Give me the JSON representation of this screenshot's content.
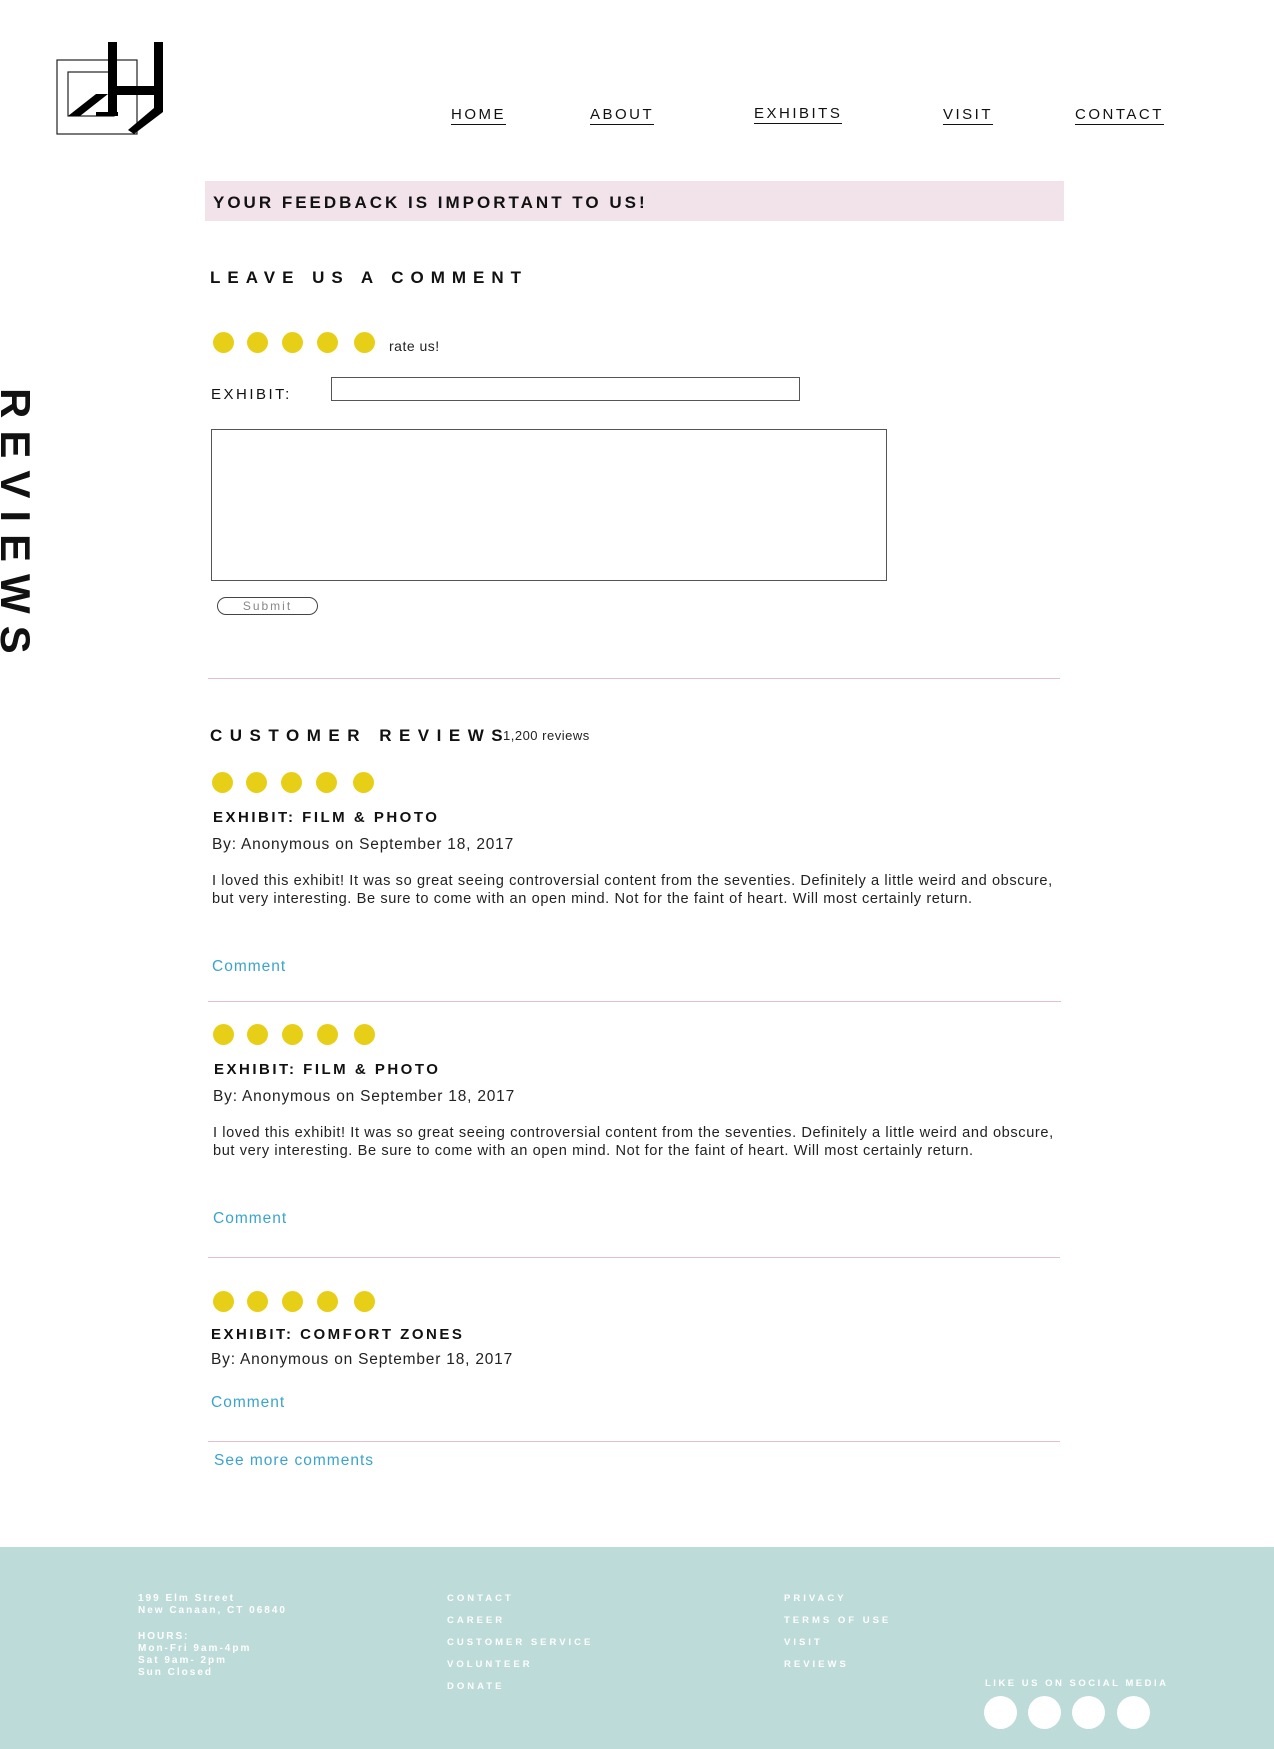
{
  "nav": {
    "home": "HOME",
    "about": "ABOUT",
    "exhibits": "EXHIBITS",
    "visit": "VISIT",
    "contact": "CONTACT"
  },
  "side_title": "REVIEWS",
  "banner": "YOUR FEEDBACK IS IMPORTANT TO US!",
  "form": {
    "heading": "LEAVE US A COMMENT",
    "rating": 5,
    "rate_label": "rate us!",
    "exhibit_label": "EXHIBIT:",
    "exhibit_value": "",
    "comment_value": "",
    "submit_label": "Submit"
  },
  "reviews": {
    "heading": "CUSTOMER REVIEWS",
    "count": "1,200 reviews",
    "items": [
      {
        "rating": 5,
        "exhibit": "EXHIBIT: FILM & PHOTO",
        "byline": "By: Anonymous on September 18, 2017",
        "text": "I loved this exhibit! It was so great seeing controversial content from the seventies. Definitely a little weird and obscure, but very interesting. Be sure to come with an open mind. Not for the faint of heart. Will most certainly return.",
        "comment_label": "Comment"
      },
      {
        "rating": 5,
        "exhibit": "EXHIBIT: FILM & PHOTO",
        "byline": "By: Anonymous on September 18, 2017",
        "text": "I loved this exhibit! It was so great seeing controversial content from the seventies. Definitely a little weird and obscure, but very interesting. Be sure to come with an open mind. Not for the faint of heart. Will most certainly return.",
        "comment_label": "Comment"
      },
      {
        "rating": 5,
        "exhibit": "EXHIBIT: COMFORT ZONES",
        "byline": "By: Anonymous on September 18, 2017",
        "text": "",
        "comment_label": "Comment"
      }
    ],
    "see_more": "See more comments"
  },
  "footer": {
    "address_line1": "199 Elm Street",
    "address_line2": "New Canaan, CT 06840",
    "hours_title": "HOURS:",
    "hours_line1": "Mon-Fri 9am-4pm",
    "hours_line2": "Sat 9am- 2pm",
    "hours_line3": "Sun Closed",
    "links_col1": [
      "CONTACT",
      "CAREER",
      "CUSTOMER SERVICE",
      "VOLUNTEER",
      "DONATE"
    ],
    "links_col2": [
      "PRIVACY",
      "TERMS OF USE",
      "VISIT",
      "REVIEWS"
    ],
    "social_title": "LIKE US ON SOCIAL MEDIA"
  },
  "colors": {
    "banner_bg": "#f1e3e9",
    "star": "#e8cf17",
    "link": "#3aa4cc",
    "divider": "#e2bfcd",
    "footer_bg": "#bddbd9"
  }
}
